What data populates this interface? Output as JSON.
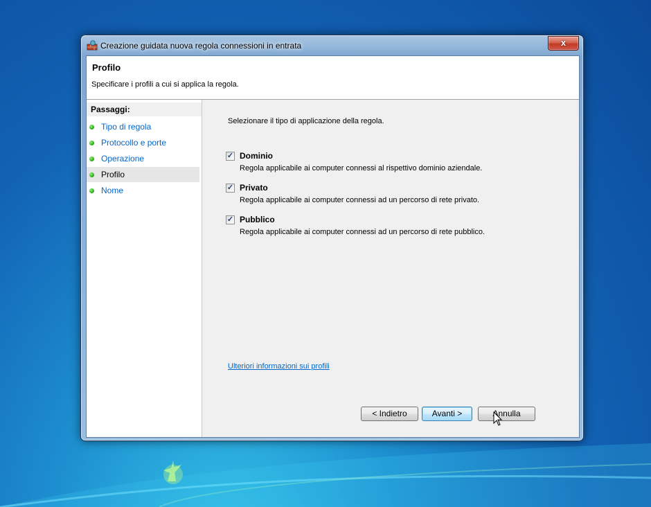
{
  "window": {
    "title": "Creazione guidata nuova regola connessioni in entrata",
    "close_label": "x"
  },
  "header": {
    "title": "Profilo",
    "description": "Specificare i profili a cui si applica la regola."
  },
  "steps": {
    "heading": "Passaggi:",
    "items": [
      {
        "label": "Tipo di regola",
        "active": false
      },
      {
        "label": "Protocollo e porte",
        "active": false
      },
      {
        "label": "Operazione",
        "active": false
      },
      {
        "label": "Profilo",
        "active": true
      },
      {
        "label": "Nome",
        "active": false
      }
    ]
  },
  "main": {
    "instruction": "Selezionare il tipo di applicazione della regola.",
    "options": [
      {
        "label": "Dominio",
        "description": "Regola applicabile ai computer connessi al rispettivo dominio aziendale.",
        "checked": true
      },
      {
        "label": "Privato",
        "description": "Regola applicabile ai computer connessi ad un percorso di rete privato.",
        "checked": true
      },
      {
        "label": "Pubblico",
        "description": "Regola applicabile ai computer connessi ad un percorso di rete pubblico.",
        "checked": true
      }
    ],
    "more_info_link": "Ulteriori informazioni sui profili"
  },
  "buttons": {
    "back": "< Indietro",
    "next": "Avanti >",
    "cancel": "Annulla"
  },
  "colors": {
    "link": "#0066cc",
    "step_dot": "#2fb21a",
    "close_button": "#c13a22"
  },
  "icons": {
    "app": "firewall-icon",
    "step": "green-dot-icon",
    "checkbox": "checkmark-icon",
    "cursor": "mouse-pointer-icon"
  }
}
